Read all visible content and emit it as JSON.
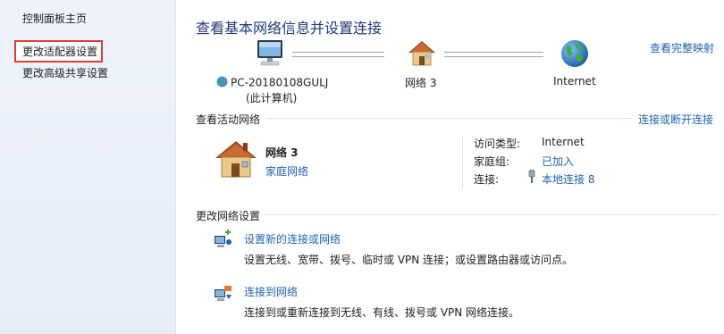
{
  "nav": {
    "home": "控制面板主页",
    "change_adapter": "更改适配器设置",
    "change_sharing": "更改高级共享设置"
  },
  "title": "查看基本网络信息并设置连接",
  "full_map_link": "查看完整映射",
  "map": {
    "computer_name": "PC-20180108GULJ",
    "computer_sub": "(此计算机)",
    "network_name": "网络  3",
    "internet": "Internet"
  },
  "active": {
    "heading": "查看活动网络",
    "connect_link": "连接或断开连接",
    "network_name": "网络  3",
    "network_type": "家庭网络",
    "access_label": "访问类型:",
    "access_value": "Internet",
    "homegroup_label": "家庭组:",
    "homegroup_value": "已加入",
    "connection_label": "连接:",
    "connection_value": "本地连接 8"
  },
  "change": {
    "heading": "更改网络设置",
    "tasks": [
      {
        "title": "设置新的连接或网络",
        "desc": "设置无线、宽带、拨号、临时或 VPN 连接；或设置路由器或访问点。"
      },
      {
        "title": "连接到网络",
        "desc": "连接到或重新连接到无线、有线、拨号或 VPN 网络连接。"
      }
    ]
  },
  "icons": [
    "computer-icon",
    "network-globe-icon",
    "house-icon",
    "internet-globe-icon",
    "house-large-icon",
    "connection-plug-icon",
    "new-connection-icon",
    "connect-network-icon"
  ]
}
